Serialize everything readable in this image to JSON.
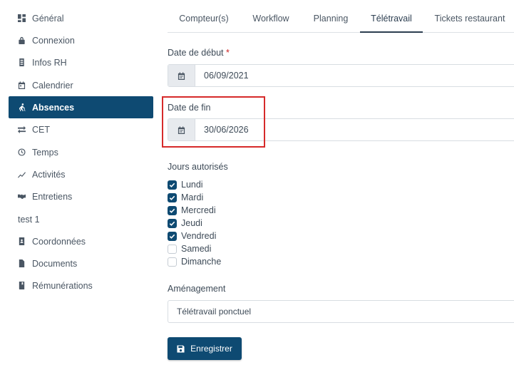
{
  "sidebar": {
    "items": [
      {
        "label": "Général",
        "icon": "dashboard-icon",
        "active": false
      },
      {
        "label": "Connexion",
        "icon": "lock-icon",
        "active": false
      },
      {
        "label": "Infos RH",
        "icon": "id-card-icon",
        "active": false
      },
      {
        "label": "Calendrier",
        "icon": "calendar-icon",
        "active": false
      },
      {
        "label": "Absences",
        "icon": "person-walking-icon",
        "active": true
      },
      {
        "label": "CET",
        "icon": "exchange-icon",
        "active": false
      },
      {
        "label": "Temps",
        "icon": "clock-icon",
        "active": false
      },
      {
        "label": "Activités",
        "icon": "chart-line-icon",
        "active": false
      },
      {
        "label": "Entretiens",
        "icon": "handshake-icon",
        "active": false
      },
      {
        "label": "test 1",
        "icon": "",
        "active": false
      },
      {
        "label": "Coordonnées",
        "icon": "address-book-icon",
        "active": false
      },
      {
        "label": "Documents",
        "icon": "file-icon",
        "active": false
      },
      {
        "label": "Rémunérations",
        "icon": "book-icon",
        "active": false
      }
    ]
  },
  "tabs": [
    {
      "label": "Compteur(s)",
      "active": false
    },
    {
      "label": "Workflow",
      "active": false
    },
    {
      "label": "Planning",
      "active": false
    },
    {
      "label": "Télétravail",
      "active": true
    },
    {
      "label": "Tickets restaurant",
      "active": false
    }
  ],
  "form": {
    "start_label": "Date de début",
    "required_mark": "*",
    "start_value": "06/09/2021",
    "end_label": "Date de fin",
    "end_value": "30/06/2026",
    "days_label": "Jours autorisés",
    "days": [
      {
        "label": "Lundi",
        "checked": true
      },
      {
        "label": "Mardi",
        "checked": true
      },
      {
        "label": "Mercredi",
        "checked": true
      },
      {
        "label": "Jeudi",
        "checked": true
      },
      {
        "label": "Vendredi",
        "checked": true
      },
      {
        "label": "Samedi",
        "checked": false
      },
      {
        "label": "Dimanche",
        "checked": false
      }
    ],
    "arrangement_label": "Aménagement",
    "arrangement_value": "Télétravail ponctuel",
    "save_label": "Enregistrer"
  },
  "colors": {
    "accent": "#0e4a72",
    "highlight": "#d62a2a",
    "required": "#cc2222"
  }
}
